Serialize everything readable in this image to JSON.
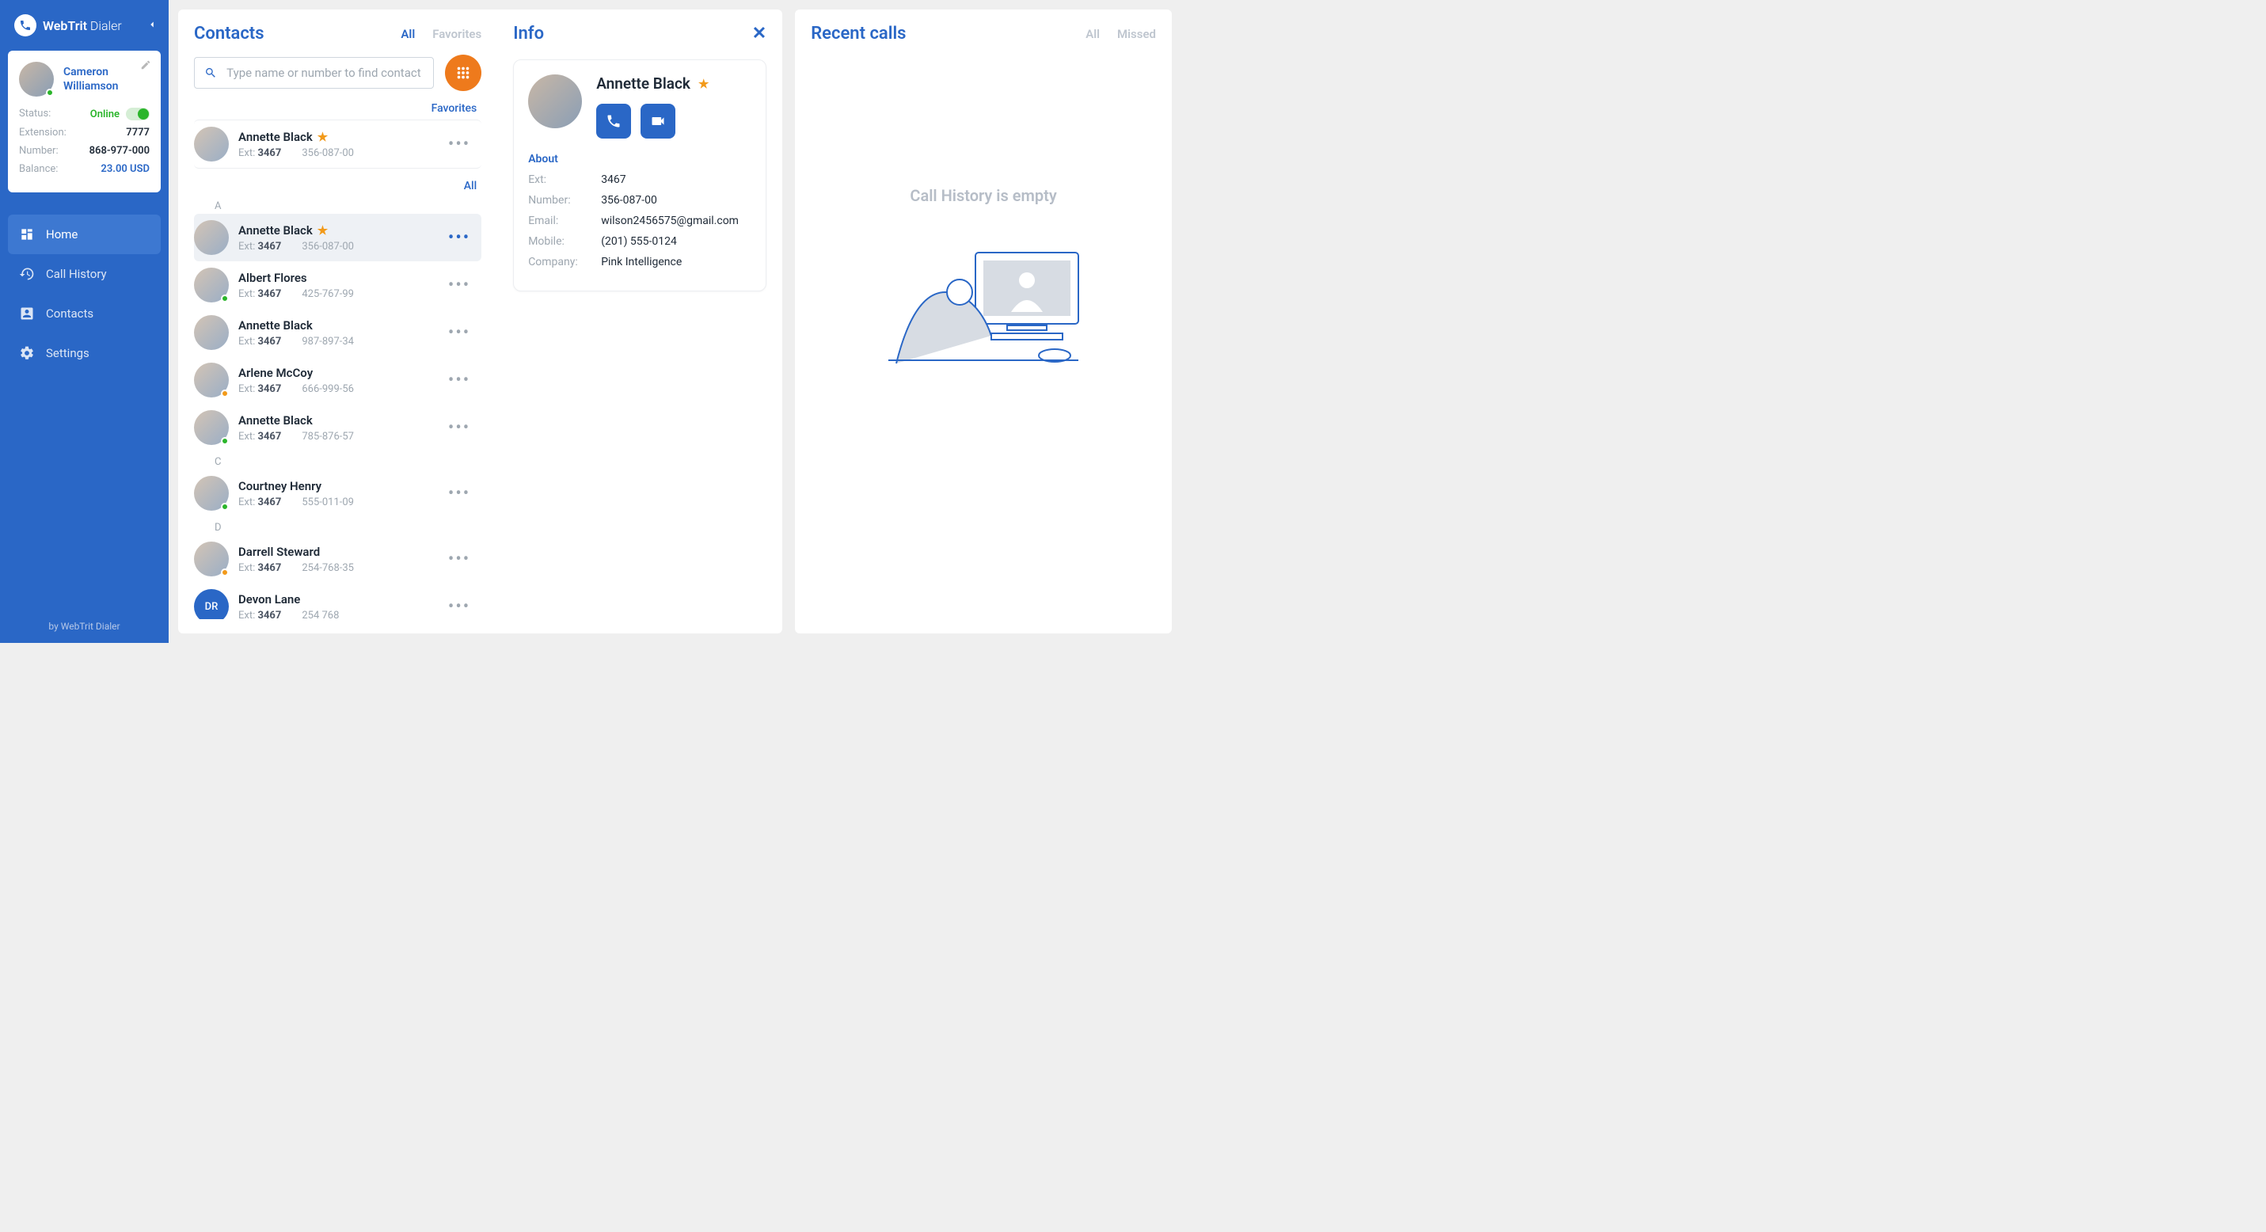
{
  "brand": {
    "name_a": "WebTrit",
    "name_b": " Dialer"
  },
  "profile": {
    "name_line1": "Cameron",
    "name_line2": "Williamson",
    "status_label": "Status:",
    "status_value": "Online",
    "extension_label": "Extension:",
    "extension_value": "7777",
    "number_label": "Number:",
    "number_value": "868-977-000",
    "balance_label": "Balance:",
    "balance_value": "23.00 USD"
  },
  "nav": {
    "home": "Home",
    "call_history": "Call History",
    "contacts": "Contacts",
    "settings": "Settings"
  },
  "footer": {
    "text": "by WebTrit Dialer"
  },
  "contacts": {
    "title": "Contacts",
    "tab_all": "All",
    "tab_fav": "Favorites",
    "search_placeholder": "Type name or number to find contact",
    "favorites_label": "Favorites",
    "all_label": "All",
    "letters": {
      "a": "A",
      "c": "C",
      "d": "D"
    },
    "list": [
      {
        "name": "Annette Black",
        "starred": true,
        "ext": "3467",
        "num": "356-087-00",
        "status": "none",
        "fav": true
      },
      {
        "name": "Annette Black",
        "starred": true,
        "ext": "3467",
        "num": "356-087-00",
        "status": "none",
        "selected": true,
        "letter": "A"
      },
      {
        "name": "Albert Flores",
        "starred": false,
        "ext": "3467",
        "num": "425-767-99",
        "status": "green"
      },
      {
        "name": "Annette Black",
        "starred": false,
        "ext": "3467",
        "num": "987-897-34",
        "status": "none"
      },
      {
        "name": "Arlene McCoy",
        "starred": false,
        "ext": "3467",
        "num": "666-999-56",
        "status": "orange"
      },
      {
        "name": "Annette Black",
        "starred": false,
        "ext": "3467",
        "num": "785-876-57",
        "status": "green"
      },
      {
        "name": "Courtney Henry",
        "starred": false,
        "ext": "3467",
        "num": "555-011-09",
        "status": "green",
        "letter": "C"
      },
      {
        "name": "Darrell Steward",
        "starred": false,
        "ext": "3467",
        "num": "254-768-35",
        "status": "orange",
        "letter": "D"
      },
      {
        "name": "Devon Lane",
        "starred": false,
        "ext": "3467",
        "num": "254 768",
        "status": "none",
        "initials": "DR"
      }
    ],
    "ext_label": "Ext:"
  },
  "info": {
    "title": "Info",
    "name": "Annette Black",
    "about_label": "About",
    "ext_label": "Ext:",
    "ext_value": "3467",
    "number_label": "Number:",
    "number_value": "356-087-00",
    "email_label": "Email:",
    "email_value": "wilson2456575@gmail.com",
    "mobile_label": "Mobile:",
    "mobile_value": "(201) 555-0124",
    "company_label": "Company:",
    "company_value": "Pink Intelligence"
  },
  "recent": {
    "title": "Recent calls",
    "tab_all": "All",
    "tab_missed": "Missed",
    "empty": "Call History is empty"
  }
}
